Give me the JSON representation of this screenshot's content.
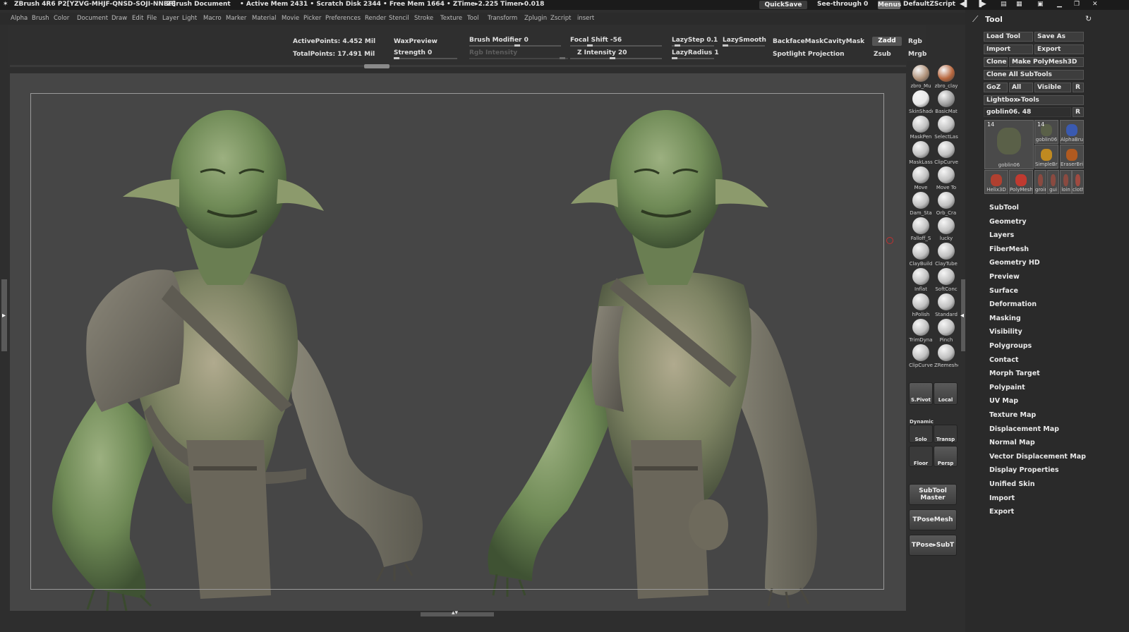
{
  "titlebar": {
    "app": "ZBrush 4R6 P2[YZVG-MHJF-QNSD-SOJI-NNBF]",
    "doc": "ZBrush Document",
    "stats": "• Active Mem 2431 • Scratch Disk 2344 • Free Mem 1664 • ZTime▸2.225 Timer▸0.018",
    "quicksave": "QuickSave",
    "seethrough": "See-through",
    "seethrough_value": "0",
    "menus": "Menus",
    "script": "DefaultZScript"
  },
  "menubar": [
    "Alpha",
    "Brush",
    "Color",
    "Document",
    "Draw",
    "Edit",
    "File",
    "Layer",
    "Light",
    "Macro",
    "Marker",
    "Material",
    "Movie",
    "Picker",
    "Preferences",
    "Render",
    "Stencil",
    "Stroke",
    "Texture",
    "Tool",
    "Transform",
    "Zplugin",
    "Zscript",
    "insert"
  ],
  "shelf": {
    "active_points": "ActivePoints: 4.452 Mil",
    "total_points": "TotalPoints: 17.491 Mil",
    "wax_preview": "WaxPreview",
    "strength": "Strength 0",
    "brush_modifier": "Brush Modifier 0",
    "rgb_intensity": "Rgb Intensity",
    "focal_shift": "Focal Shift -56",
    "z_intensity": "Z Intensity 20",
    "lazystep": "LazyStep 0.1",
    "lazysmooth": "LazySmooth",
    "lazyradius": "LazyRadius 1",
    "backface": "BackfaceMask",
    "cavity": "CavityMask",
    "spotlight": "Spotlight Projection",
    "zadd": "Zadd",
    "zsub": "Zsub",
    "rgb": "Rgb",
    "mrgb": "Mrgb"
  },
  "brushes": [
    {
      "label": "zbro_Mu",
      "color": "#b0927a"
    },
    {
      "label": "zbro_clay",
      "color": "#b8673e"
    },
    {
      "label": "SkinShade",
      "color": "#e8e8e8"
    },
    {
      "label": "BasicMat",
      "color": "#a0a0a0"
    },
    {
      "label": "MaskPen",
      "color": "#c0c0c0"
    },
    {
      "label": "SelectLas",
      "color": "#c0c0c0"
    },
    {
      "label": "MaskLass",
      "color": "#c0c0c0"
    },
    {
      "label": "ClipCurve",
      "color": "#c0c0c0"
    },
    {
      "label": "Move",
      "color": "#c0c0c0"
    },
    {
      "label": "Move To",
      "color": "#c0c0c0"
    },
    {
      "label": "Dam_Sta",
      "color": "#c0c0c0"
    },
    {
      "label": "Orb_Cra",
      "color": "#c0c0c0"
    },
    {
      "label": "Falloff_S",
      "color": "#c0c0c0"
    },
    {
      "label": "lucky",
      "color": "#c0c0c0"
    },
    {
      "label": "ClayBuild",
      "color": "#c0c0c0"
    },
    {
      "label": "ClayTube",
      "color": "#c0c0c0"
    },
    {
      "label": "Inflat",
      "color": "#c0c0c0"
    },
    {
      "label": "SoftConc",
      "color": "#c0c0c0"
    },
    {
      "label": "hPolish",
      "color": "#c0c0c0"
    },
    {
      "label": "Standard",
      "color": "#c0c0c0"
    },
    {
      "label": "TrimDyna",
      "color": "#c0c0c0"
    },
    {
      "label": "Pinch",
      "color": "#c0c0c0"
    },
    {
      "label": "ClipCurve",
      "color": "#c0c0c0"
    },
    {
      "label": "ZRemeshe",
      "color": "#c0c0c0"
    }
  ],
  "sidecol": {
    "spivot": "S.Pivot",
    "local": "Local",
    "dynamic": "Dynamic",
    "solo": "Solo",
    "transp": "Transp",
    "floor": "Floor",
    "persp": "Persp",
    "subtool_master": "SubTool Master",
    "tposemesh": "TPoseMesh",
    "tpose_subt": "TPose▸SubT"
  },
  "tool": {
    "title": "Tool",
    "load_tool": "Load Tool",
    "save_as": "Save As",
    "import": "Import",
    "export": "Export",
    "clone": "Clone",
    "make_polymesh": "Make PolyMesh3D",
    "clone_all": "Clone All SubTools",
    "goz": "GoZ",
    "all": "All",
    "visible": "Visible",
    "r": "R",
    "lightbox": "Lightbox▸Tools",
    "current": "goblin06. 48",
    "thumbs": [
      {
        "label": "goblin06",
        "num": "14"
      },
      {
        "label": "goblin06",
        "num": "14"
      },
      {
        "label": "AlphaBrus",
        "num": ""
      },
      {
        "label": "SimpleBri",
        "num": ""
      },
      {
        "label": "EraserBri",
        "num": ""
      },
      {
        "label": "Helix3D",
        "num": ""
      },
      {
        "label": "PolyMesh",
        "num": ""
      },
      {
        "label": "groin",
        "num": ""
      },
      {
        "label": "gui",
        "num": ""
      },
      {
        "label": "loin",
        "num": ""
      },
      {
        "label": "cloth",
        "num": ""
      }
    ],
    "items": [
      "SubTool",
      "Geometry",
      "Layers",
      "FiberMesh",
      "Geometry HD",
      "Preview",
      "Surface",
      "Deformation",
      "Masking",
      "Visibility",
      "Polygroups",
      "Contact",
      "Morph Target",
      "Polypaint",
      "UV Map",
      "Texture Map",
      "Displacement Map",
      "Normal Map",
      "Vector Displacement Map",
      "Display Properties",
      "Unified Skin",
      "Import",
      "Export"
    ]
  },
  "colors": {
    "skin": "#6f8a56",
    "armor": "#6e6a5c",
    "canvas": "#464646"
  }
}
